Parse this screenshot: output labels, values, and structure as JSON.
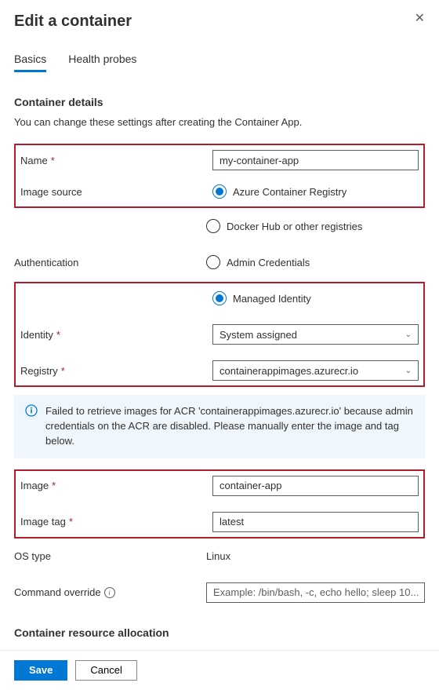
{
  "header": {
    "title": "Edit a container"
  },
  "tabs": {
    "basics": "Basics",
    "health_probes": "Health probes"
  },
  "section": {
    "details_head": "Container details",
    "details_desc": "You can change these settings after creating the Container App.",
    "resource_head": "Container resource allocation"
  },
  "labels": {
    "name": "Name",
    "image_source": "Image source",
    "authentication": "Authentication",
    "identity": "Identity",
    "registry": "Registry",
    "image": "Image",
    "image_tag": "Image tag",
    "os_type": "OS type",
    "command_override": "Command override"
  },
  "fields": {
    "name_value": "my-container-app",
    "source_acr": "Azure Container Registry",
    "source_docker": "Docker Hub or other registries",
    "auth_admin": "Admin Credentials",
    "auth_mi": "Managed Identity",
    "identity_value": "System assigned",
    "registry_value": "containerappimages.azurecr.io",
    "image_value": "container-app",
    "image_tag_value": "latest",
    "os_value": "Linux",
    "cmd_placeholder": "Example: /bin/bash, -c, echo hello; sleep 10..."
  },
  "info": {
    "msg": "Failed to retrieve images for ACR 'containerappimages.azurecr.io' because admin credentials on the ACR are disabled. Please manually enter the image and tag below."
  },
  "footer": {
    "save": "Save",
    "cancel": "Cancel"
  }
}
